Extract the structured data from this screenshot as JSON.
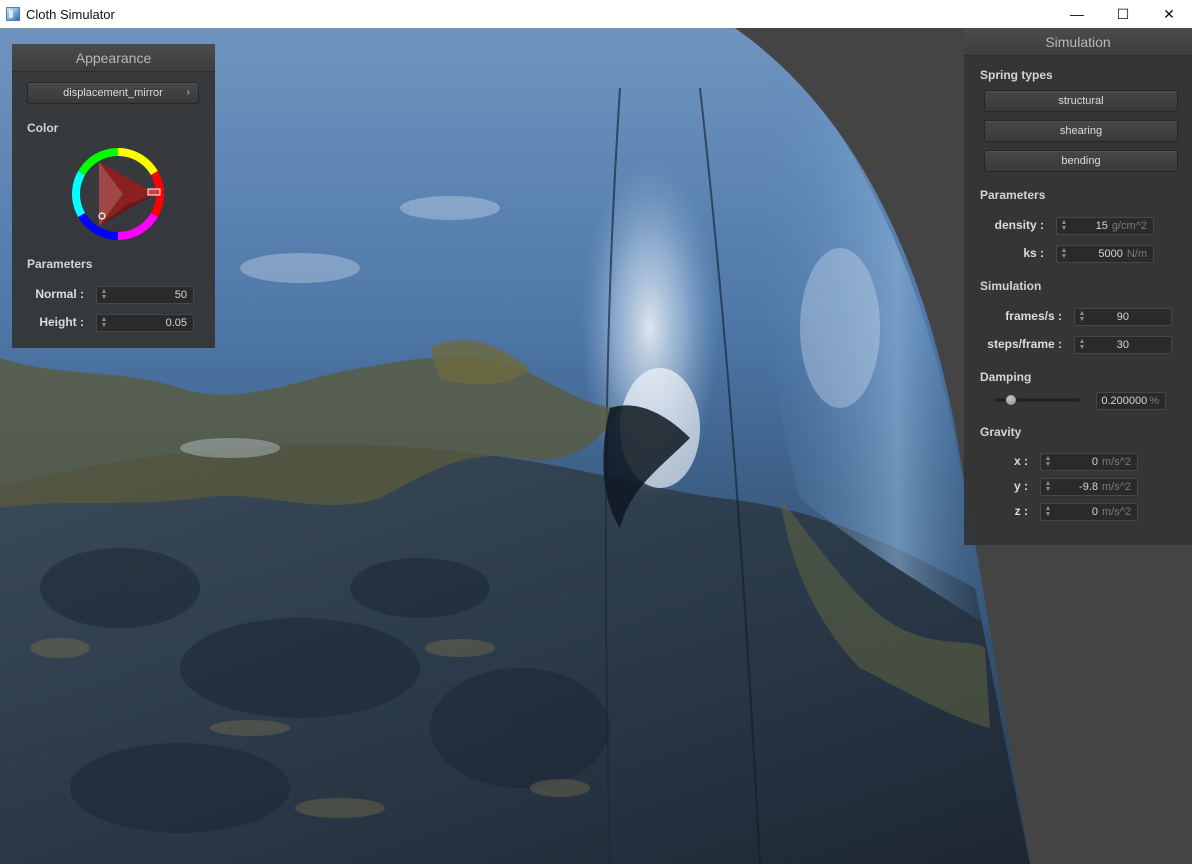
{
  "window": {
    "title": "Cloth Simulator",
    "minimize_glyph": "—",
    "maximize_glyph": "☐",
    "close_glyph": "✕"
  },
  "appearance": {
    "title": "Appearance",
    "shader_button": "displacement_mirror",
    "shader_chevron": "›",
    "color_label": "Color",
    "parameters_label": "Parameters",
    "normal_label": "Normal :",
    "normal_value": "50",
    "height_label": "Height :",
    "height_value": "0.05"
  },
  "simulation": {
    "title": "Simulation",
    "spring_types_label": "Spring types",
    "structural": "structural",
    "shearing": "shearing",
    "bending": "bending",
    "parameters_label": "Parameters",
    "density_label": "density :",
    "density_value": "15",
    "density_unit": "g/cm^2",
    "ks_label": "ks :",
    "ks_value": "5000",
    "ks_unit": "N/m",
    "simulation_label": "Simulation",
    "fps_label": "frames/s :",
    "fps_value": "90",
    "steps_label": "steps/frame :",
    "steps_value": "30",
    "damping_label": "Damping",
    "damping_value": "0.200000",
    "damping_unit": "%",
    "damping_fraction": 0.2,
    "gravity_label": "Gravity",
    "gx_label": "x :",
    "gx_value": "0",
    "gy_label": "y :",
    "gy_value": "-9.8",
    "gz_label": "z :",
    "gz_value": "0",
    "gravity_unit": "m/s^2"
  },
  "colors": {
    "accent_picker_marker": "#d83a3a",
    "selected_color": "#c03030"
  }
}
